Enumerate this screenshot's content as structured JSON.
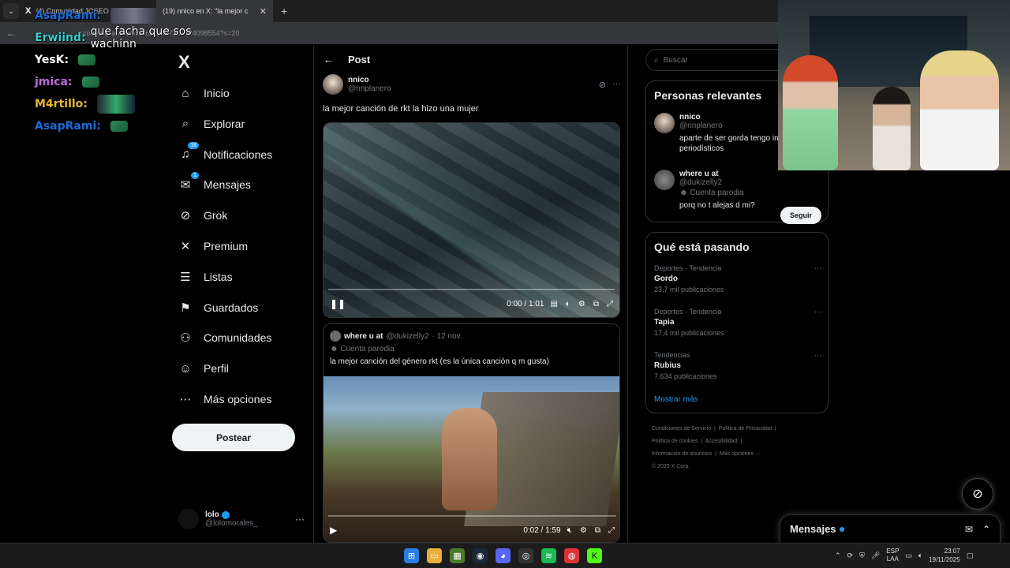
{
  "browser": {
    "tabs": [
      {
        "title": "(4) Comunidad JOSEO E"
      },
      {
        "title": "(19) nnico en X: \"la mejor c"
      }
    ],
    "new_tab_symbol": "+",
    "url": "x.com/nnplanero/status/19897307724098554?s=20"
  },
  "chat": [
    {
      "user": "AsapRami:",
      "color": "#1e6bd6",
      "message": "",
      "emote": "img"
    },
    {
      "user": "Erwiind:",
      "color": "#3ccfcf",
      "message": "que facha que sos wachinn",
      "emote": ""
    },
    {
      "user": "YesK:",
      "color": "#ffffff",
      "message": "",
      "emote": "green"
    },
    {
      "user": "jmica:",
      "color": "#c06ad6",
      "message": "",
      "emote": "green"
    },
    {
      "user": "M4rtillo:",
      "color": "#e6b62f",
      "message": "",
      "emote": "img2"
    },
    {
      "user": "AsapRami:",
      "color": "#1e6bd6",
      "message": "",
      "emote": "green"
    }
  ],
  "sidebar": {
    "logo": "X",
    "items": [
      {
        "label": "Inicio",
        "icon": "home-icon",
        "glyph": "⌂",
        "badge": ""
      },
      {
        "label": "Explorar",
        "icon": "search-icon",
        "glyph": "⌕",
        "badge": ""
      },
      {
        "label": "Notificaciones",
        "icon": "bell-icon",
        "glyph": "♫",
        "badge": "18"
      },
      {
        "label": "Mensajes",
        "icon": "mail-icon",
        "glyph": "✉",
        "badge": "1"
      },
      {
        "label": "Grok",
        "icon": "grok-icon",
        "glyph": "⊘",
        "badge": ""
      },
      {
        "label": "Premium",
        "icon": "x-icon",
        "glyph": "✕",
        "badge": ""
      },
      {
        "label": "Listas",
        "icon": "list-icon",
        "glyph": "☰",
        "badge": ""
      },
      {
        "label": "Guardados",
        "icon": "bookmark-icon",
        "glyph": "⚑",
        "badge": ""
      },
      {
        "label": "Comunidades",
        "icon": "communities-icon",
        "glyph": "⚇",
        "badge": ""
      },
      {
        "label": "Perfil",
        "icon": "person-icon",
        "glyph": "☺",
        "badge": ""
      },
      {
        "label": "Más opciones",
        "icon": "more-circle-icon",
        "glyph": "⋯",
        "badge": ""
      }
    ],
    "post_button": "Postear",
    "account": {
      "name": "lolo",
      "handle": "@lolomorales_",
      "more": "···"
    }
  },
  "post": {
    "header": "Post",
    "back": "←",
    "author_name": "nnico",
    "author_handle": "@nnplanero",
    "text": "la mejor canción de rkt la hizo una mujer",
    "video": {
      "time": "0:00 / 1:01",
      "progress": 0.0,
      "state": "playing"
    },
    "quote": {
      "name": "where u at",
      "handle": "@dukizelly2",
      "date": "· 12 nov.",
      "parody": "Cuenta parodia",
      "text": "la mejor canción del género rkt (es la única canción q m gusta)",
      "video": {
        "time": "0:02 / 1:59",
        "progress": 0.02,
        "state": "paused"
      }
    }
  },
  "right": {
    "search_placeholder": "Buscar",
    "relevant": {
      "title": "Personas relevantes",
      "people": [
        {
          "name": "nnico",
          "handle": "@nnplanero",
          "bio": "aparte de ser gorda tengo in artísticos y periodísticos",
          "parody": ""
        },
        {
          "name": "where u at",
          "handle": "@dukizelly2",
          "bio": "porq no t alejas d mi?",
          "parody": "Cuenta parodia"
        }
      ],
      "follow": "Seguir"
    },
    "trends": {
      "title": "Qué está pasando",
      "items": [
        {
          "category": "Deportes · Tendencia",
          "name": "Gordo",
          "count": "23,7 mil publicaciones"
        },
        {
          "category": "Deportes · Tendencia",
          "name": "Tapia",
          "count": "17,4 mil publicaciones"
        },
        {
          "category": "Tendencias",
          "name": "Rubius",
          "count": "7.634 publicaciones"
        }
      ],
      "show_more": "Mostrar más"
    },
    "footer": [
      "Condiciones de Servicio",
      "Política de Privacidad",
      "Política de cookies",
      "Accesibilidad",
      "Información de anuncios",
      "Más opciones ···",
      "© 2025 X Corp."
    ]
  },
  "messages_dock": {
    "title": "Mensajes"
  },
  "taskbar": {
    "lang": [
      "ESP",
      "LAA"
    ],
    "time": "23:07",
    "date": "19/11/2025"
  }
}
